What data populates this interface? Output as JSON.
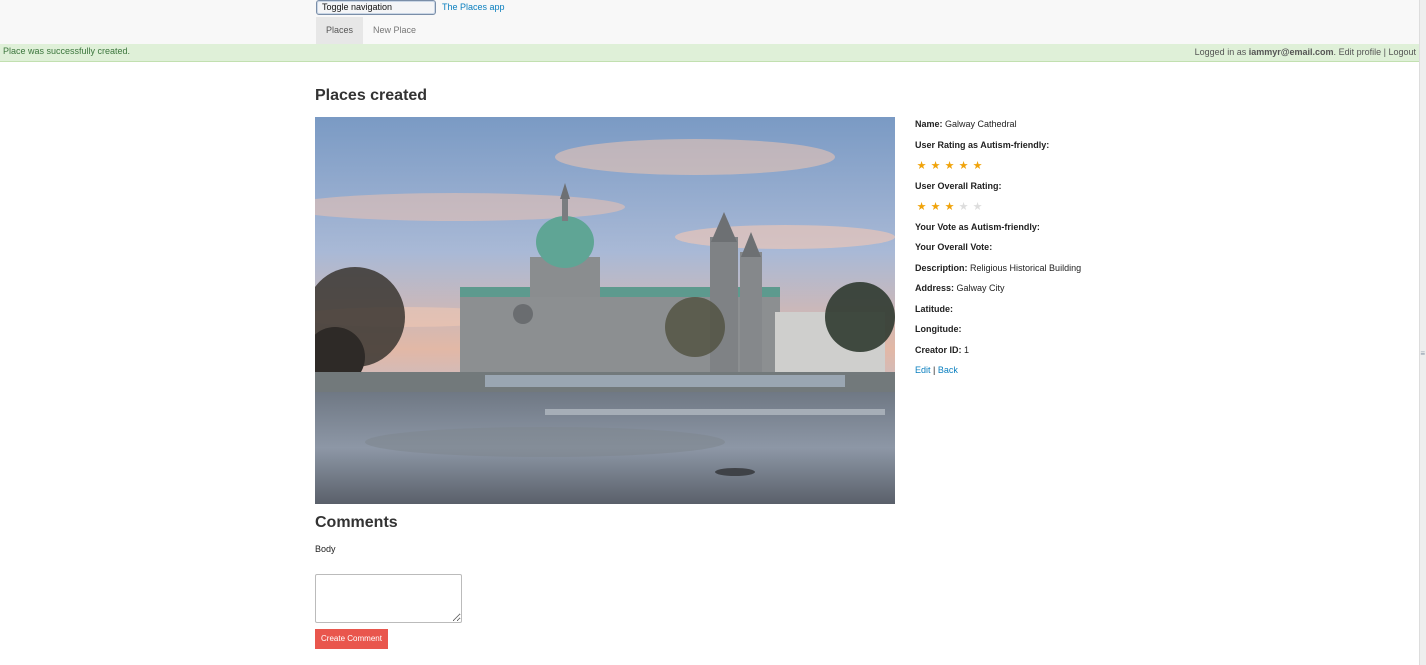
{
  "navbar": {
    "toggle_label": "Toggle navigation",
    "brand": "The Places app",
    "tabs": [
      {
        "label": "Places",
        "active": true
      },
      {
        "label": "New Place",
        "active": false
      }
    ]
  },
  "alert": {
    "notice": "Place was successfully created.",
    "logged_in_prefix": "Logged in as",
    "email": "iammyr@email.com",
    "edit_profile": "Edit profile",
    "separator": "|",
    "logout": "Logout"
  },
  "page": {
    "title": "Places created"
  },
  "place": {
    "image_alt": "Galway Cathedral",
    "name_label": "Name:",
    "name": "Galway Cathedral",
    "autism_rating_label": "User Rating as Autism-friendly:",
    "autism_rating": 5,
    "overall_rating_label": "User Overall Rating:",
    "overall_rating": 3,
    "max_rating": 5,
    "your_autism_vote_label": "Your Vote as Autism-friendly:",
    "your_overall_vote_label": "Your Overall Vote:",
    "description_label": "Description:",
    "description": "Religious Historical Building",
    "address_label": "Address:",
    "address": "Galway City",
    "latitude_label": "Latitude:",
    "longitude_label": "Longitude:",
    "creator_label": "Creator ID:",
    "creator_id": "1",
    "edit_link": "Edit",
    "link_separator": "|",
    "back_link": "Back"
  },
  "comments": {
    "title": "Comments",
    "body_label": "Body",
    "body_value": "",
    "submit_label": "Create Comment"
  },
  "colors": {
    "link": "#0a7fbf",
    "star_on": "#f0a30a",
    "star_off": "#dddddd",
    "alert_bg": "#dff0d8",
    "submit_bg": "#e9564d"
  },
  "icons": {
    "star": "star-icon",
    "resize": "resize-grip-icon"
  }
}
